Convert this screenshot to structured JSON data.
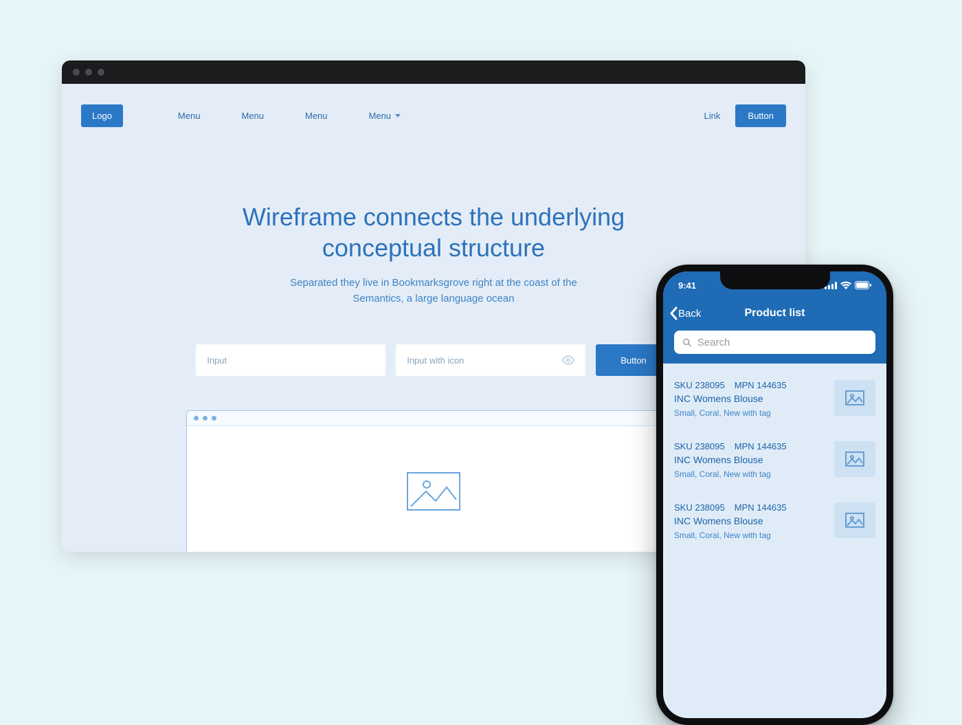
{
  "desktop": {
    "logo": "Logo",
    "menus": [
      "Menu",
      "Menu",
      "Menu",
      "Menu"
    ],
    "menu_has_chevron_index": 3,
    "link": "Link",
    "nav_button": "Button",
    "hero_title": "Wireframe connects the underlying conceptual structure",
    "hero_subtitle": "Separated they live in Bookmarksgrove right at the coast of the Semantics, a large language ocean",
    "input1_placeholder": "Input",
    "input2_placeholder": "Input with icon",
    "cta_button": "Button"
  },
  "phone": {
    "statusbar_time": "9:41",
    "back_label": "Back",
    "title": "Product list",
    "search_placeholder": "Search",
    "items": [
      {
        "sku": "SKU 238095",
        "mpn": "MPN 144635",
        "name": "INC Womens Blouse",
        "sub": "Small, Coral, New with tag"
      },
      {
        "sku": "SKU 238095",
        "mpn": "MPN 144635",
        "name": "INC Womens Blouse",
        "sub": "Small, Coral, New with tag"
      },
      {
        "sku": "SKU 238095",
        "mpn": "MPN 144635",
        "name": "INC Womens Blouse",
        "sub": "Small, Coral, New with tag"
      }
    ]
  }
}
